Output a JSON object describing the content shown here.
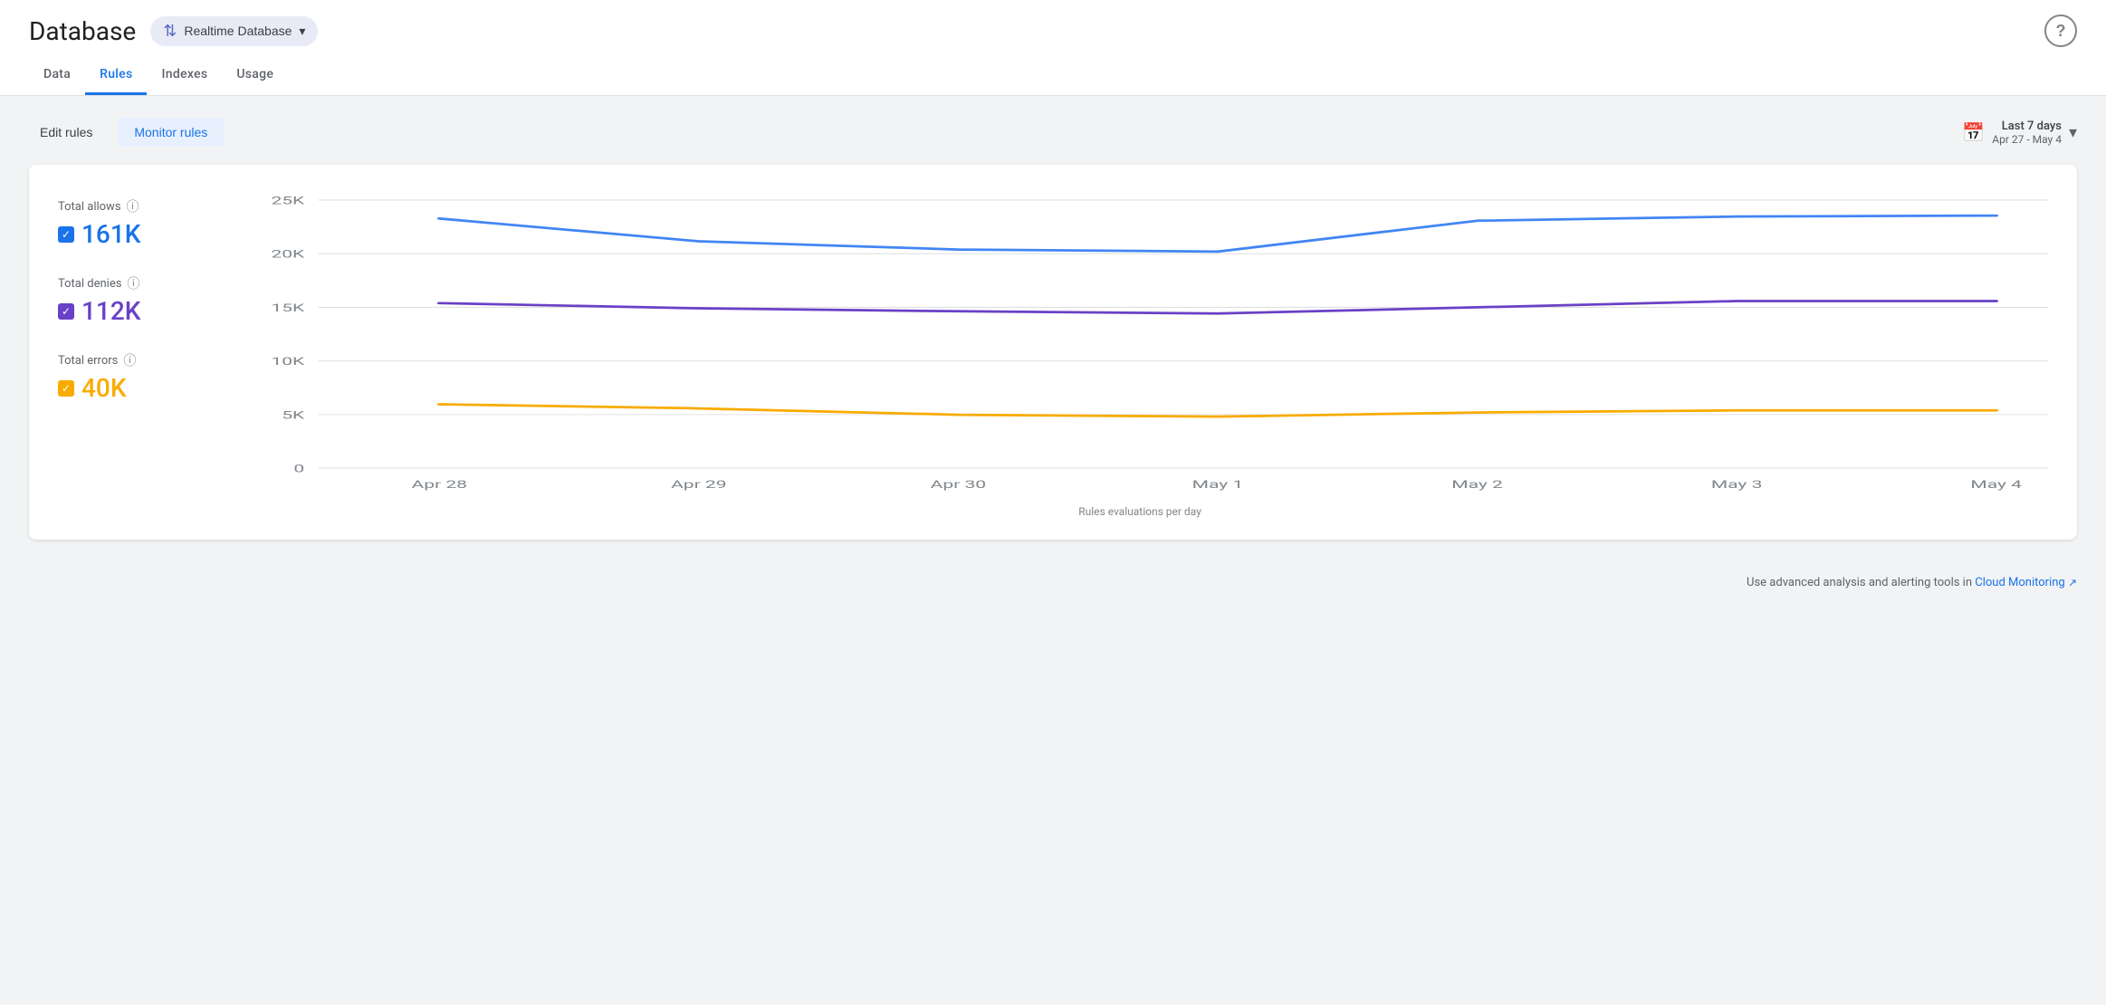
{
  "header": {
    "title": "Database",
    "db_selector_label": "Realtime Database",
    "help_label": "?"
  },
  "tabs": [
    {
      "id": "data",
      "label": "Data",
      "active": false
    },
    {
      "id": "rules",
      "label": "Rules",
      "active": true
    },
    {
      "id": "indexes",
      "label": "Indexes",
      "active": false
    },
    {
      "id": "usage",
      "label": "Usage",
      "active": false
    }
  ],
  "toolbar": {
    "edit_rules_label": "Edit rules",
    "monitor_rules_label": "Monitor rules"
  },
  "date_range": {
    "title": "Last 7 days",
    "subtitle": "Apr 27 - May 4"
  },
  "chart": {
    "title": "Rules evaluations per day",
    "y_labels": [
      "25K",
      "20K",
      "15K",
      "10K",
      "5K",
      "0"
    ],
    "x_labels": [
      "Apr 28",
      "Apr 29",
      "Apr 30",
      "May 1",
      "May 2",
      "May 3",
      "May 4"
    ],
    "series": [
      {
        "id": "allows",
        "label": "Total allows",
        "value": "161K",
        "color": "#4285f4",
        "checkbox_color": "blue-cb",
        "value_class": "blue",
        "points": [
          24200,
          22000,
          21200,
          21000,
          24000,
          24400,
          24500
        ]
      },
      {
        "id": "denies",
        "label": "Total denies",
        "value": "112K",
        "color": "#6941c6",
        "checkbox_color": "purple-cb",
        "value_class": "purple",
        "points": [
          16000,
          15500,
          15200,
          15000,
          15600,
          16200,
          16200
        ]
      },
      {
        "id": "errors",
        "label": "Total errors",
        "value": "40K",
        "color": "#f9ab00",
        "checkbox_color": "yellow-cb",
        "value_class": "yellow",
        "points": [
          6200,
          5800,
          5200,
          5000,
          5400,
          5600,
          5600
        ]
      }
    ]
  },
  "footer": {
    "note": "Use advanced analysis and alerting tools in",
    "link_text": "Cloud Monitoring"
  },
  "colors": {
    "active_tab": "#1a73e8",
    "blue": "#4285f4",
    "purple": "#6941c6",
    "yellow": "#f9ab00"
  }
}
